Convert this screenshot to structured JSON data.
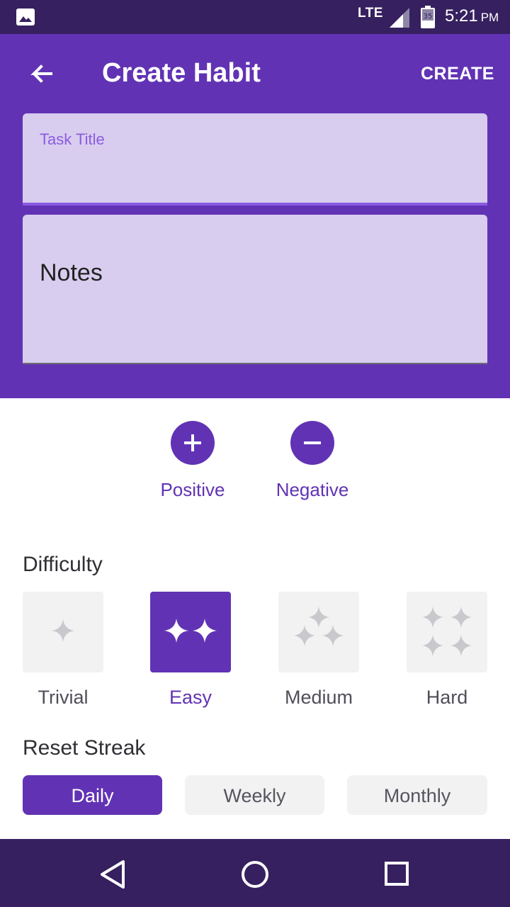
{
  "status_bar": {
    "network": "LTE",
    "battery_level": "35",
    "time": "5:21",
    "ampm": "PM",
    "icons": [
      "image-icon",
      "signal-icon",
      "battery-icon"
    ]
  },
  "header": {
    "title": "Create Habit",
    "create_label": "CREATE",
    "back_icon": "arrow-left-icon"
  },
  "form": {
    "task_title_label": "Task Title",
    "task_title_value": "",
    "notes_label": "Notes",
    "notes_value": ""
  },
  "habit_type": {
    "positive_label": "Positive",
    "negative_label": "Negative",
    "positive_icon": "plus-icon",
    "negative_icon": "minus-icon"
  },
  "difficulty": {
    "title": "Difficulty",
    "options": [
      {
        "label": "Trivial",
        "stars": 1,
        "selected": false
      },
      {
        "label": "Easy",
        "stars": 2,
        "selected": true
      },
      {
        "label": "Medium",
        "stars": 3,
        "selected": false
      },
      {
        "label": "Hard",
        "stars": 4,
        "selected": false
      }
    ]
  },
  "reset_streak": {
    "title": "Reset Streak",
    "options": [
      {
        "label": "Daily",
        "selected": true
      },
      {
        "label": "Weekly",
        "selected": false
      },
      {
        "label": "Monthly",
        "selected": false
      }
    ]
  },
  "nav": {
    "icons": [
      "back-triangle-icon",
      "home-circle-icon",
      "recents-square-icon"
    ]
  },
  "colors": {
    "primary": "#6133b4",
    "status_bar": "#36205f",
    "field_bg": "#d8cdee",
    "accent": "#8a5ae4",
    "chip_bg": "#f2f2f3"
  }
}
